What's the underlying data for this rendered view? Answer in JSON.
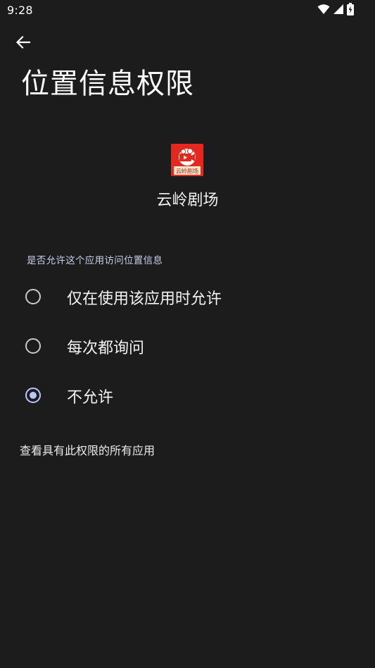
{
  "status_bar": {
    "time": "9:28",
    "icons": [
      "wifi-icon",
      "cellular-signal-icon",
      "battery-charging-icon"
    ]
  },
  "header": {
    "back_icon": "arrow-back-icon",
    "title": "位置信息权限"
  },
  "app": {
    "name": "云岭剧场",
    "icon_label": "云岭剧场",
    "icon_colors": {
      "background": "#e5281f",
      "banner": "#f5e6c8",
      "banner_text": "#b3201a",
      "camera_bg": "#ffffff",
      "play": "#e5281f"
    }
  },
  "permission": {
    "question": "是否允许这个应用访问位置信息",
    "options": [
      {
        "label": "仅在使用该应用时允许",
        "checked": false
      },
      {
        "label": "每次都询问",
        "checked": false
      },
      {
        "label": "不允许",
        "checked": true
      }
    ]
  },
  "footer": {
    "see_all_link": "查看具有此权限的所有应用"
  },
  "colors": {
    "background": "#1c1c1c",
    "accent": "#b9c6ff",
    "text_primary": "#f2f2f2",
    "section_header": "#c9cde6"
  }
}
